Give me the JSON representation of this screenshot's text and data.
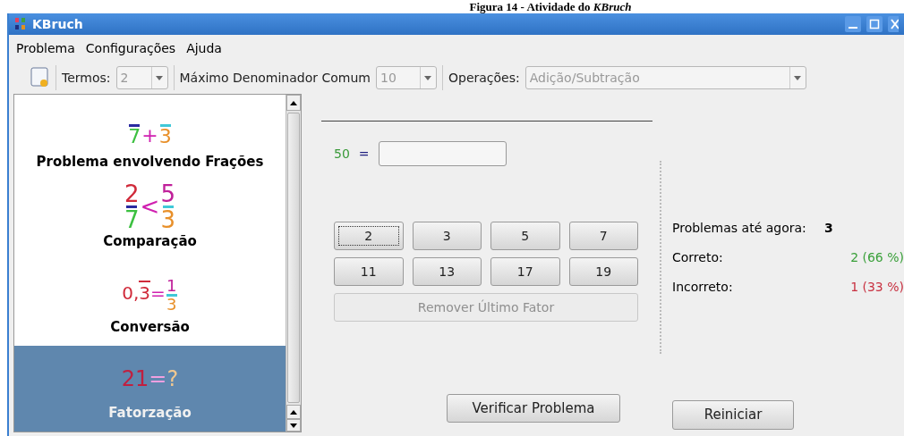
{
  "caption": "Figura 14 - Atividade do *KBruch*",
  "window": {
    "title": "KBruch"
  },
  "menu": [
    "Problema",
    "Configurações",
    "Ajuda"
  ],
  "toolbar": {
    "terms_label": "Termos:",
    "terms_value": "2",
    "max_label": "Máximo Denominador Comum",
    "max_value": "10",
    "ops_label": "Operações:",
    "ops_value": "Adição/Subtração"
  },
  "sidebar": {
    "items": [
      {
        "kind": "fraction_op",
        "left": {
          "den": "7"
        },
        "op": "+",
        "right": {
          "den": "3"
        },
        "label": "Problema envolvendo Frações",
        "selected": false
      },
      {
        "kind": "fraction_op",
        "left": {
          "num": "2",
          "den": "7"
        },
        "op": "<",
        "right": {
          "num": "5",
          "den": "3"
        },
        "label": "Comparação",
        "selected": false
      },
      {
        "kind": "conversion",
        "decimal": "0,",
        "repeating": "3",
        "op": "=",
        "right": {
          "num": "1",
          "den": "3"
        },
        "label": "Conversão",
        "selected": false
      },
      {
        "kind": "factorization",
        "number": "21",
        "op": "=",
        "unknown": "?",
        "label": "Fatorzação",
        "selected": true
      }
    ]
  },
  "task": {
    "number": "50",
    "equals": "="
  },
  "factor_buttons": [
    "2",
    "3",
    "5",
    "7",
    "11",
    "13",
    "17",
    "19"
  ],
  "remove_button": {
    "label": "Remover Último Fator",
    "disabled": true
  },
  "check_button": "Verificar Problema",
  "stats": {
    "total_label": "Problemas até agora:",
    "total": "3",
    "correct_label": "Correto:",
    "correct": "2 (66 %)",
    "incorrect_label": "Incorreto:",
    "incorrect": "1 (33 %)"
  },
  "reset_button": "Reiniciar"
}
